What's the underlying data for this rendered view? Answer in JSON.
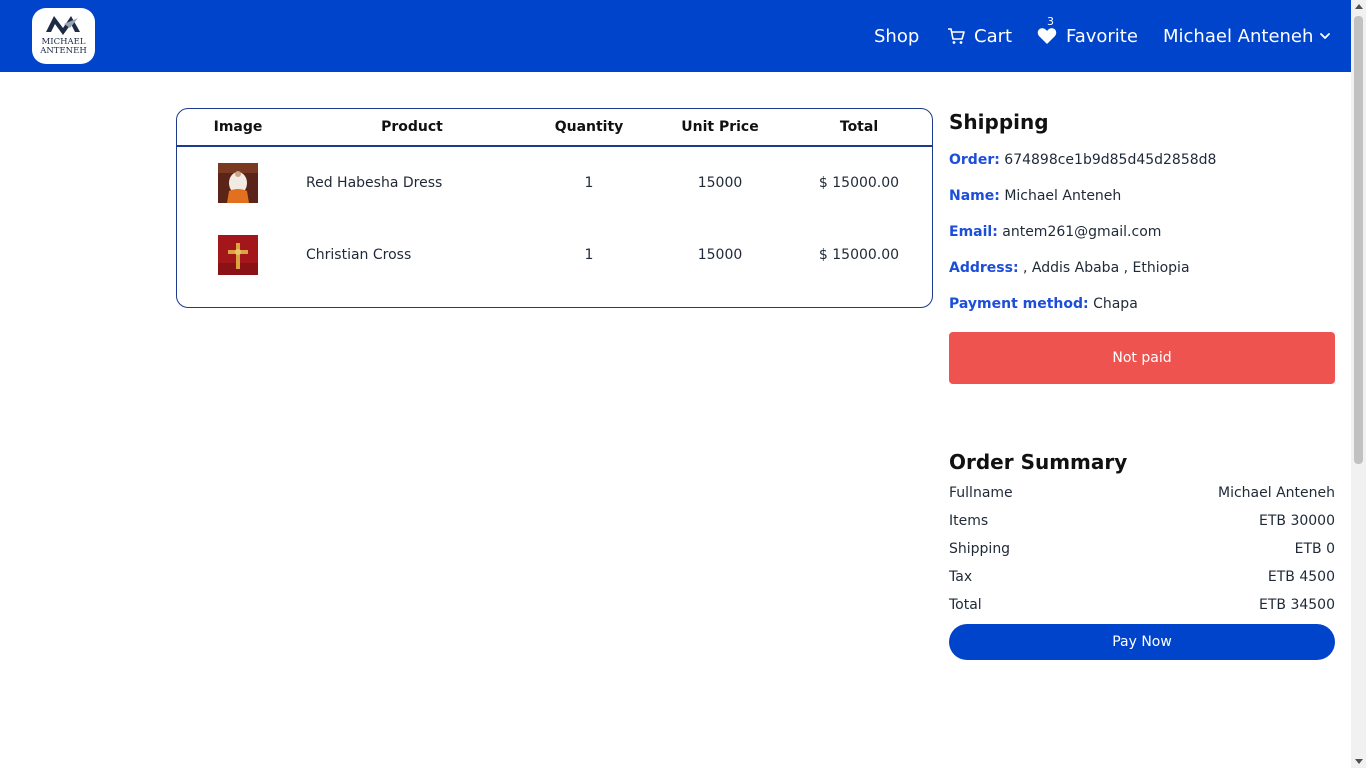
{
  "navbar": {
    "logo_alt": "MICHAEL ANTENEH",
    "logo_line1": "MICHAEL",
    "logo_line2": "ANTENEH",
    "shop_label": "Shop",
    "cart_label": "Cart",
    "favorite_label": "Favorite",
    "favorite_count": "3",
    "user_label": "Michael Anteneh",
    "icons": {
      "cart": "cart-icon",
      "favorite": "heart-icon",
      "user_menu": "chevron-down-icon"
    }
  },
  "table": {
    "headers": [
      "Image",
      "Product",
      "Quantity",
      "Unit Price",
      "Total"
    ],
    "rows": [
      {
        "product": "Red Habesha Dress",
        "quantity": "1",
        "unit_price": "15000",
        "total": "$ 15000.00"
      },
      {
        "product": "Christian Cross",
        "quantity": "1",
        "unit_price": "15000",
        "total": "$ 15000.00"
      }
    ]
  },
  "shipping": {
    "title": "Shipping",
    "order_label": "Order:",
    "order_value": "674898ce1b9d85d45d2858d8",
    "name_label": "Name:",
    "name_value": "Michael Anteneh",
    "email_label": "Email:",
    "email_value": "antem261@gmail.com",
    "address_label": "Address:",
    "address_value": ", Addis Ababa , Ethiopia",
    "payment_label": "Payment method:",
    "payment_value": "Chapa",
    "status": "Not paid"
  },
  "summary": {
    "title": "Order Summary",
    "rows": [
      {
        "label": "Fullname",
        "value": "Michael Anteneh"
      },
      {
        "label": "Items",
        "value": "ETB 30000"
      },
      {
        "label": "Shipping",
        "value": "ETB 0"
      },
      {
        "label": "Tax",
        "value": "ETB 4500"
      },
      {
        "label": "Total",
        "value": "ETB 34500"
      }
    ],
    "pay_button": "Pay Now"
  },
  "colors": {
    "primary": "#0044cc",
    "accent_label": "#1d4ed8",
    "not_paid": "#ef5350",
    "table_border": "#1e3a8a"
  }
}
